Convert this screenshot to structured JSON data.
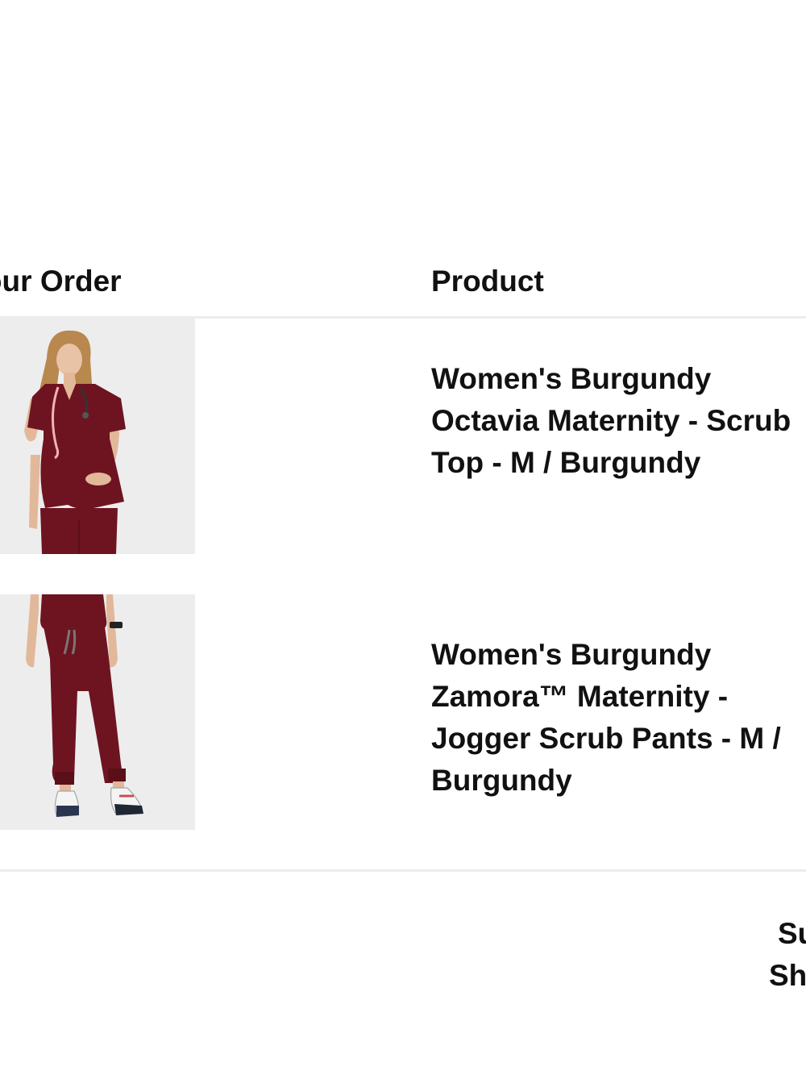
{
  "table": {
    "order_header": "Your Order",
    "product_header": "Product"
  },
  "items": [
    {
      "name": "Women's Burgundy Octavia Maternity - Scrub Top - M / Burgundy",
      "image_icon": "model-scrub-top-image"
    },
    {
      "name": "Women's Burgundy Zamora™ Maternity - Jogger Scrub Pants - M / Burgundy",
      "image_icon": "model-jogger-pants-image"
    }
  ],
  "summary": {
    "subtotal_label": "Subtotal",
    "shipping_label": "Shipping"
  },
  "colors": {
    "burgundy": "#6e1420",
    "divider": "#ececec",
    "thumb_bg": "#ededed"
  }
}
